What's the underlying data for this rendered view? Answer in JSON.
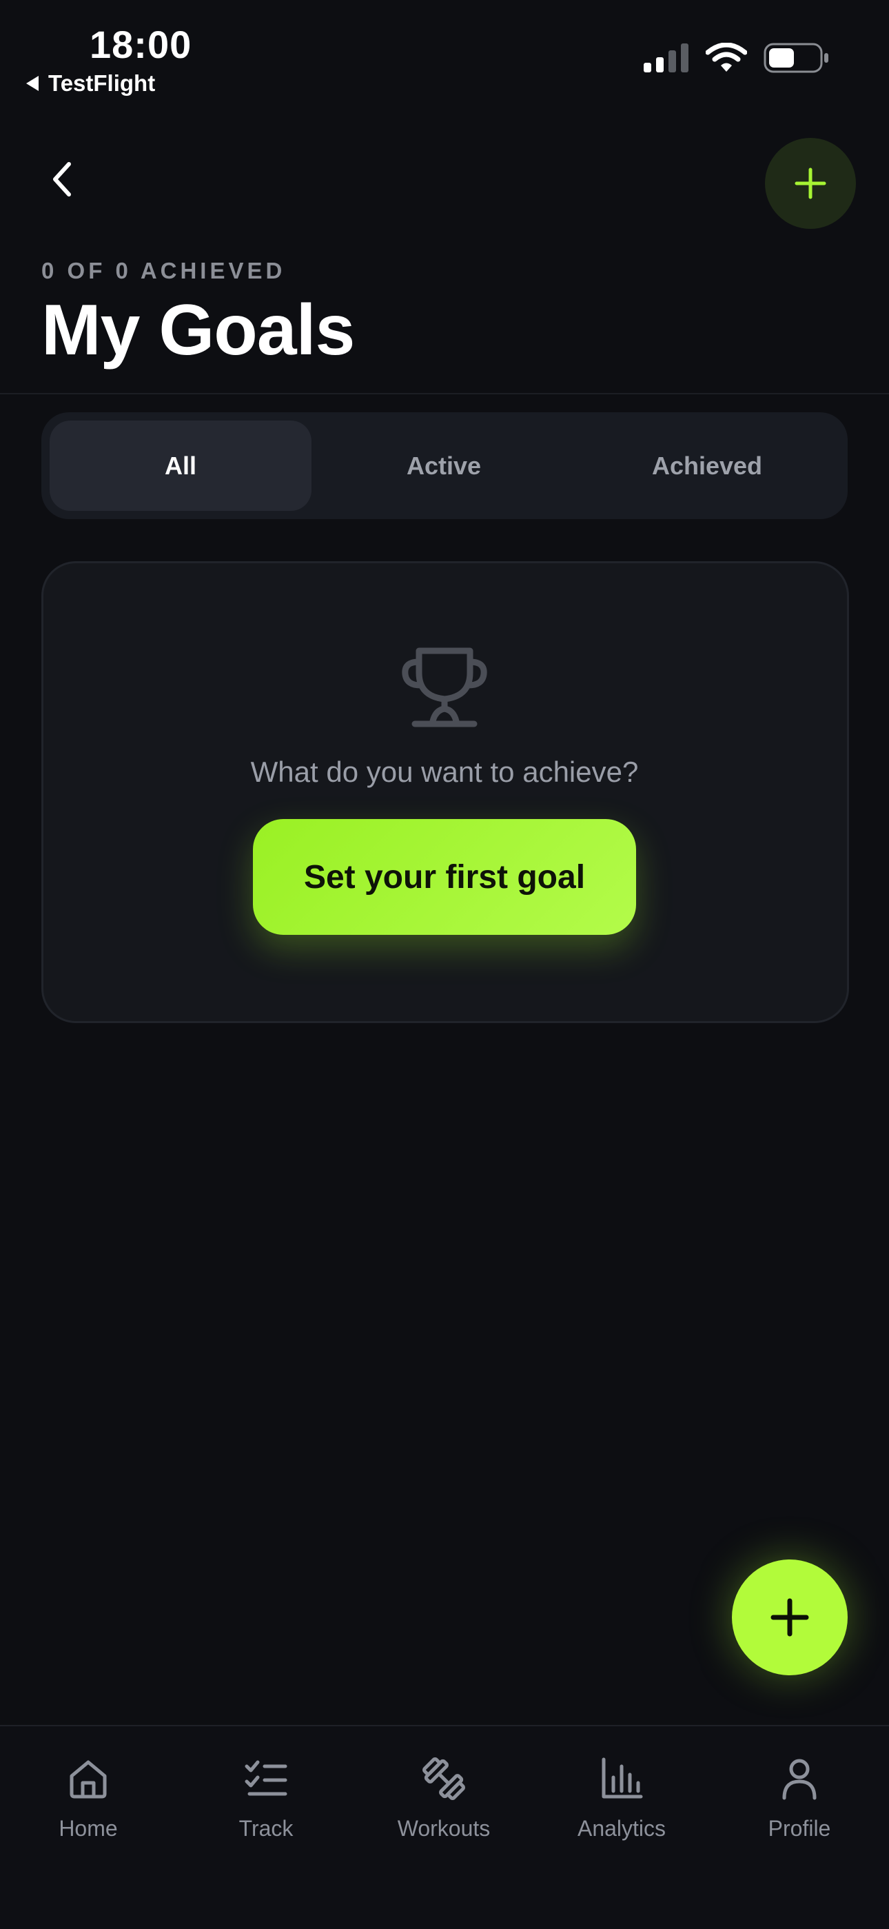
{
  "status_bar": {
    "time": "18:00",
    "back_app": "TestFlight",
    "icons": [
      "cellular-signal-icon",
      "wifi-icon",
      "battery-icon"
    ]
  },
  "header": {
    "back_icon": "chevron-left-icon",
    "add_icon": "plus-icon",
    "subtitle": "0 OF 0 ACHIEVED",
    "title": "My Goals"
  },
  "filter_tabs": {
    "items": [
      {
        "label": "All",
        "selected": true
      },
      {
        "label": "Active",
        "selected": false
      },
      {
        "label": "Achieved",
        "selected": false
      }
    ]
  },
  "empty_state": {
    "icon": "trophy-icon",
    "message": "What do you want to achieve?",
    "cta_label": "Set your first goal"
  },
  "fab": {
    "icon": "plus-icon"
  },
  "tab_bar": {
    "items": [
      {
        "label": "Home",
        "icon": "home-icon"
      },
      {
        "label": "Track",
        "icon": "checklist-icon"
      },
      {
        "label": "Workouts",
        "icon": "dumbbell-icon"
      },
      {
        "label": "Analytics",
        "icon": "bar-chart-icon"
      },
      {
        "label": "Profile",
        "icon": "person-icon"
      }
    ]
  },
  "colors": {
    "background": "#0d0e12",
    "accent": "#b2fb3a",
    "card": "#15171c",
    "muted_text": "#9a9ea8"
  }
}
